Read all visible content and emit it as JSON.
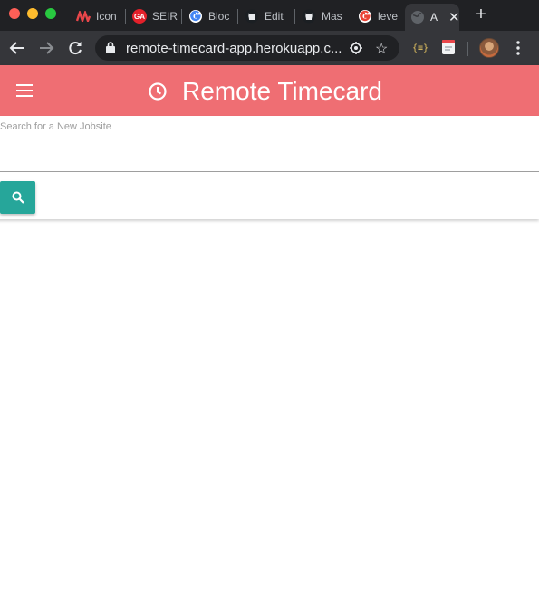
{
  "browser": {
    "tabs": [
      {
        "label": "Icon",
        "icon": "stripes-logo-icon",
        "color": "#e8464a"
      },
      {
        "label": "SEIR",
        "icon": "ga-logo-icon",
        "color": "#e3202a",
        "badge": "GA"
      },
      {
        "label": "Bloc",
        "icon": "google-logo-icon",
        "color": "#4285f4"
      },
      {
        "label": "Edit",
        "icon": "github-logo-icon",
        "color": "#1b1f23"
      },
      {
        "label": "Mas",
        "icon": "github-logo-icon",
        "color": "#1b1f23"
      },
      {
        "label": "leve",
        "icon": "google-logo-icon",
        "color": "#4285f4"
      },
      {
        "label": "A",
        "icon": "globe-icon",
        "color": "#5f6368",
        "active": true
      }
    ],
    "url": "remote-timecard-app.herokuapp.c..."
  },
  "app": {
    "title": "Remote Timecard",
    "accent": "#ef6e73",
    "search": {
      "label": "Search for a New Jobsite",
      "value": "",
      "button_icon": "search-icon",
      "button_color": "#26a69a"
    }
  }
}
